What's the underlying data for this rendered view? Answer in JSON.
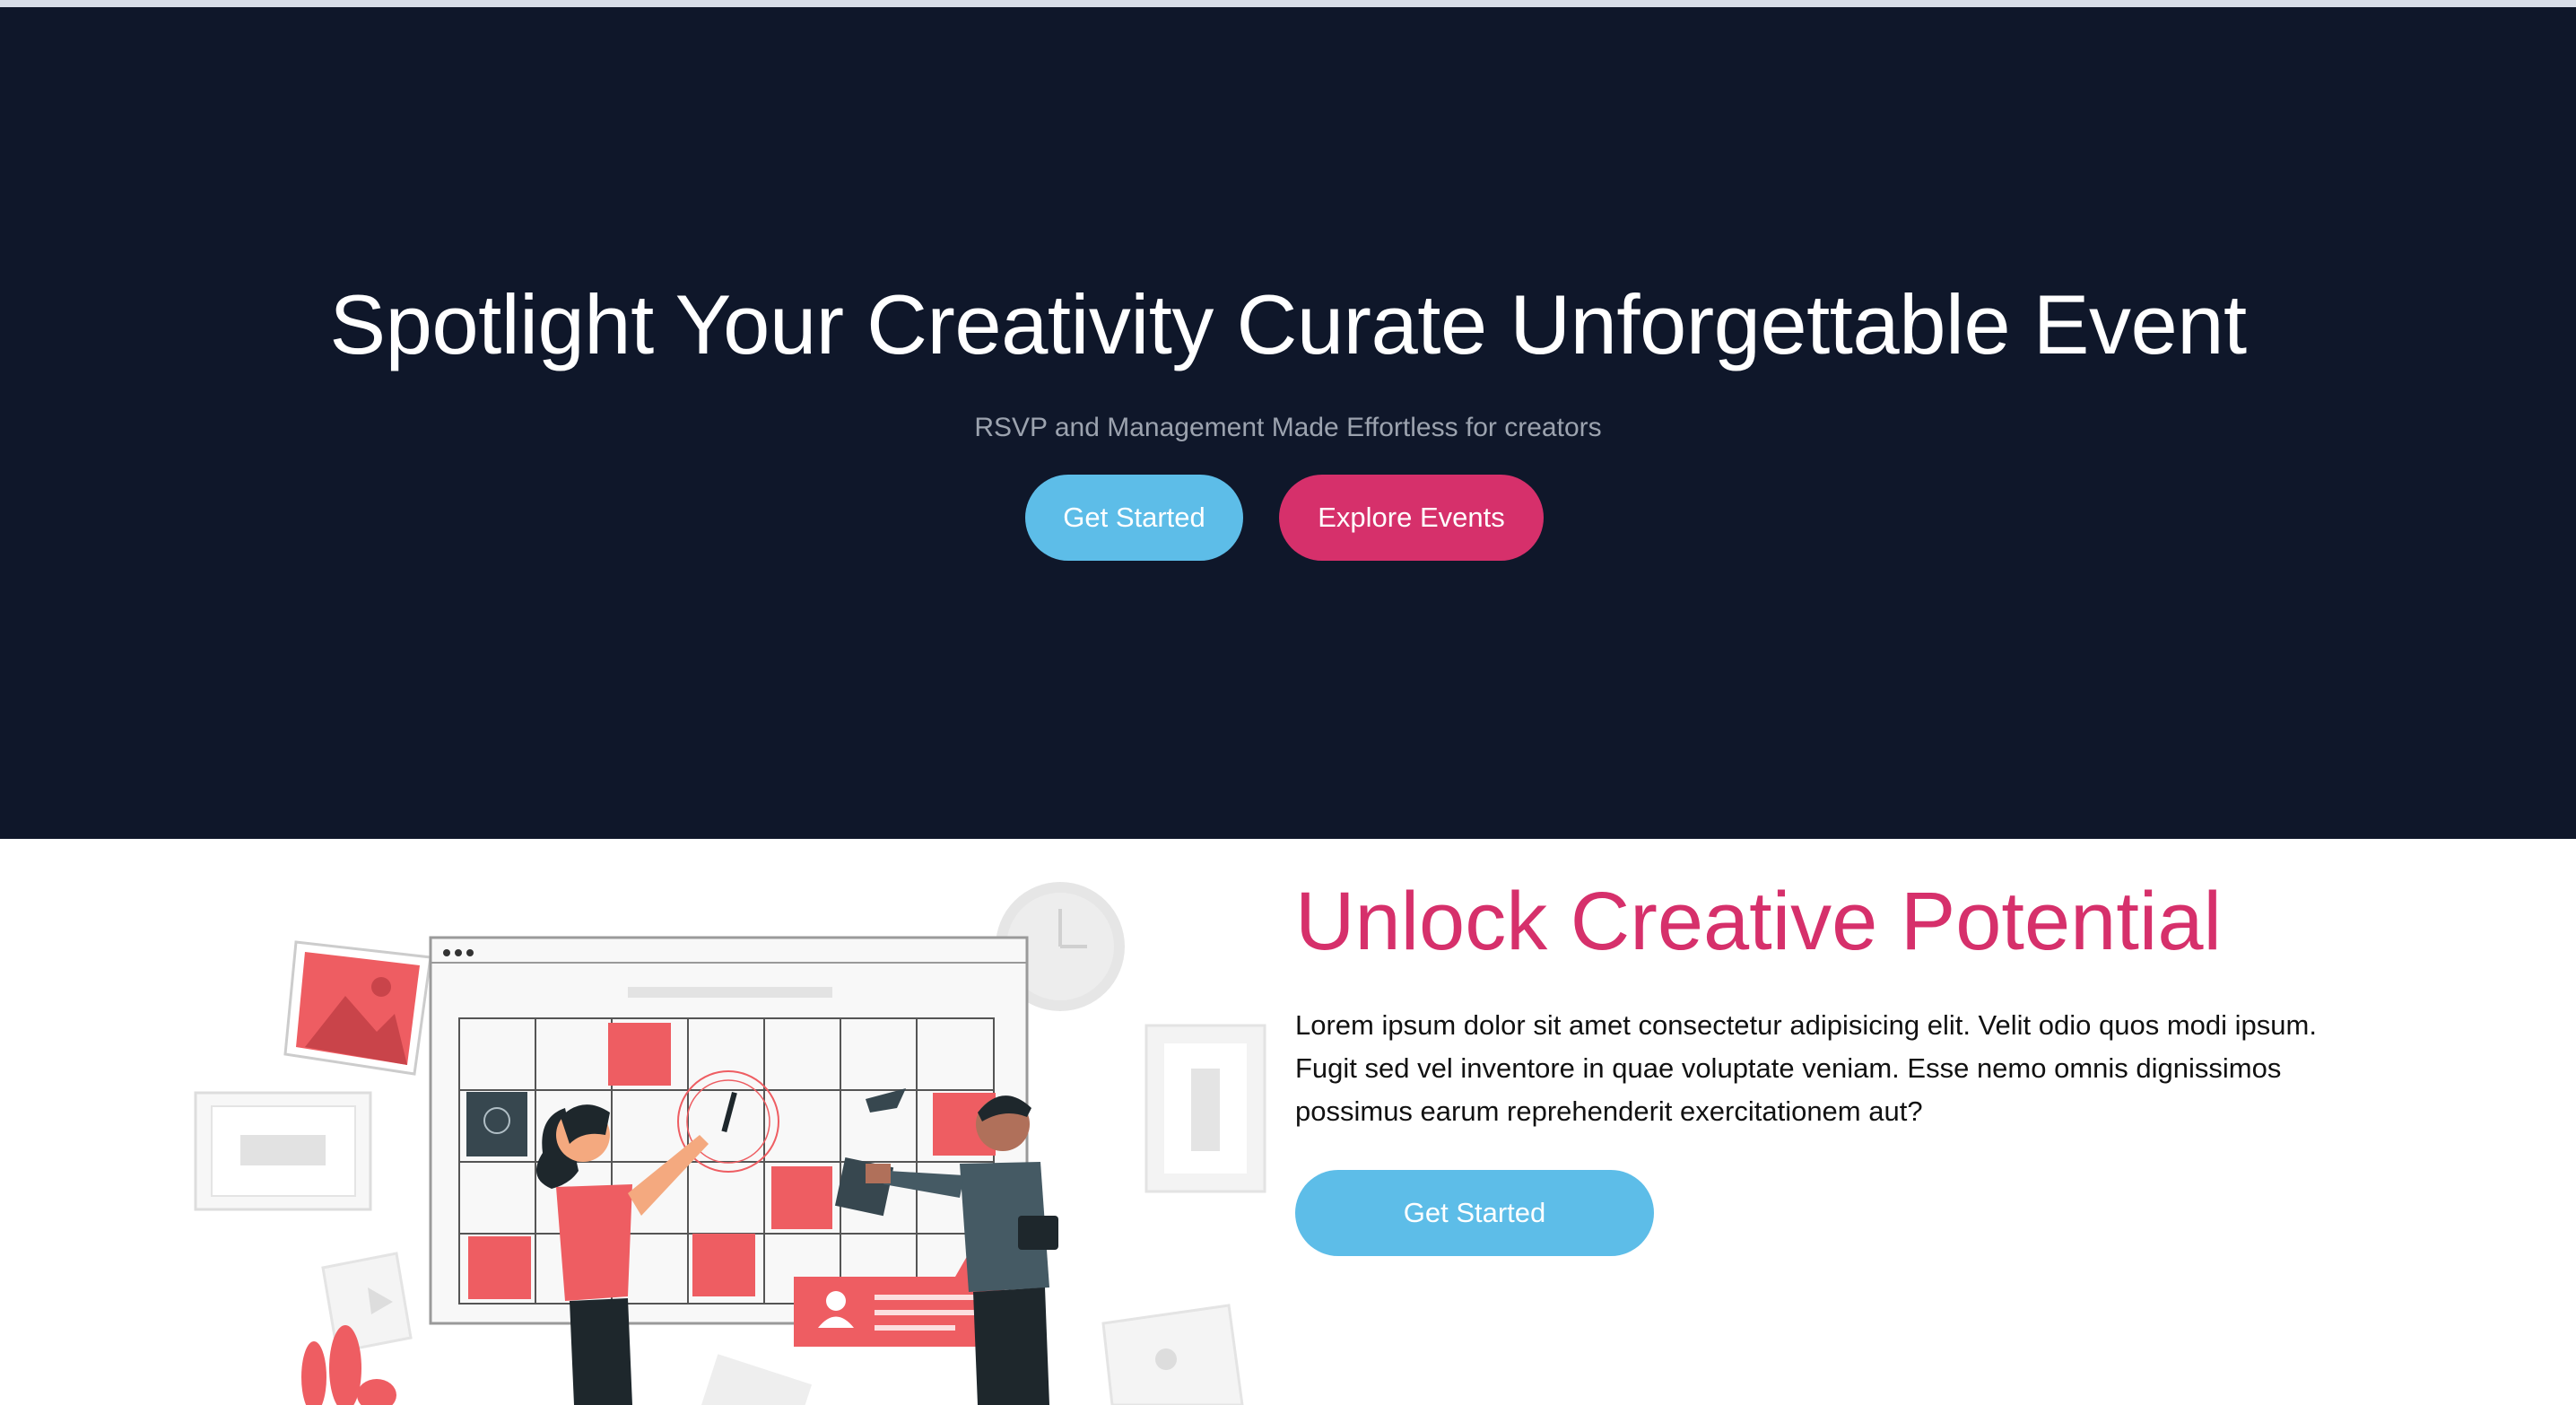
{
  "hero": {
    "title": "Spotlight Your Creativity Curate Unforgettable Event",
    "subtitle": "RSVP and Management Made Effortless for creators",
    "primary_button": "Get Started",
    "secondary_button": "Explore Events"
  },
  "feature": {
    "title": "Unlock Creative Potential",
    "body": "Lorem ipsum dolor sit amet consectetur adipisicing elit. Velit odio quos modi ipsum. Fugit sed vel inventore in quae voluptate veniam. Esse nemo omnis dignissimos possimus earum reprehenderit exercitationem aut?",
    "button": "Get Started",
    "illustration": "planning-calendar-illustration"
  },
  "colors": {
    "hero_bg": "#0f172a",
    "accent_blue": "#5dbde8",
    "accent_pink": "#d6306b",
    "illustration_red": "#ee5d62"
  }
}
